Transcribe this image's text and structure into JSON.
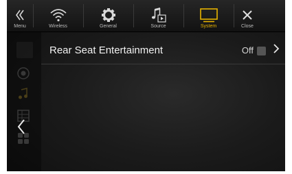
{
  "tabs": {
    "menu": "Menu",
    "wireless": "Wireless",
    "general": "General",
    "source": "Source",
    "system": "System",
    "close": "Close"
  },
  "active_tab": "System",
  "accent_color": "#e8b400",
  "setting": {
    "label": "Rear Seat Entertainment",
    "state": "Off"
  },
  "icons": [
    "menu-double-chevron-icon",
    "wifi-icon",
    "gear-icon",
    "music-note-icon",
    "monitor-icon",
    "close-icon",
    "chevron-left-icon",
    "chevron-right-icon"
  ]
}
